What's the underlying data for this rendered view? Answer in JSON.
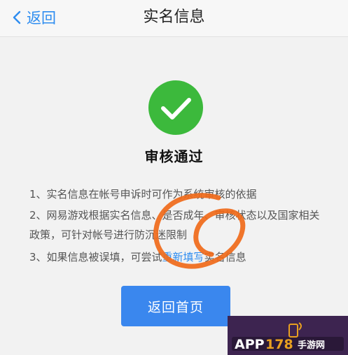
{
  "nav": {
    "back_label": "返回",
    "title": "实名信息"
  },
  "status": {
    "icon": "check-circle-icon",
    "title": "审核通过"
  },
  "notes": {
    "note1": "1、实名信息在帐号申诉时可作为系统审核的依据",
    "note2": "2、网易游戏根据实名信息、是否成年、审核状态以及国家相关政策，可针对帐号进行防沉迷限制",
    "note3_prefix": "3、如果信息被误填，可尝试",
    "note3_link": "重新填写",
    "note3_suffix": "实名信息"
  },
  "button": {
    "home_label": "返回首页"
  },
  "watermark": {
    "text": "APP178 手游网"
  },
  "colors": {
    "accent": "#2d8cf0",
    "success": "#3cb93c",
    "button": "#3a87ee",
    "annotation": "#f06a1a"
  }
}
